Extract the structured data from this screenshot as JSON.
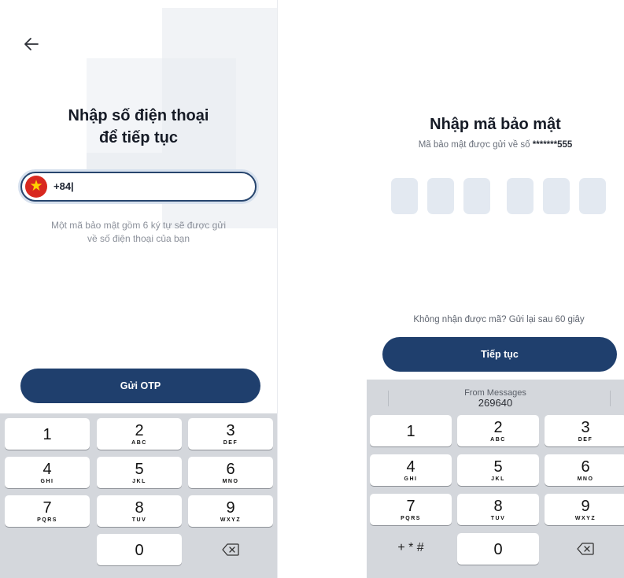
{
  "left": {
    "title_line1": "Nhập số điện thoại",
    "title_line2": "để tiếp tục",
    "phone_value": "+84|",
    "hint_line1": "Một mã bảo mật gồm 6 ký tự sẽ được gửi",
    "hint_line2": "về số điện thoại của bạn",
    "button_label": "Gửi OTP",
    "back_icon": "arrow-left-icon",
    "flag_icon": "vietnam-flag-icon"
  },
  "right": {
    "title": "Nhập mã bảo mật",
    "subtitle_prefix": "Mã bảo mật được gửi về số",
    "subtitle_number": "*******555",
    "resend_text": "Không nhận được mã? Gửi lại sau 60 giây",
    "button_label": "Tiếp tục",
    "suggestion_from": "From Messages",
    "suggestion_code": "269640",
    "special_key": "+ * #"
  },
  "keypad": {
    "keys": [
      {
        "digit": "1",
        "letters": ""
      },
      {
        "digit": "2",
        "letters": "ABC"
      },
      {
        "digit": "3",
        "letters": "DEF"
      },
      {
        "digit": "4",
        "letters": "GHI"
      },
      {
        "digit": "5",
        "letters": "JKL"
      },
      {
        "digit": "6",
        "letters": "MNO"
      },
      {
        "digit": "7",
        "letters": "PQRS"
      },
      {
        "digit": "8",
        "letters": "TUV"
      },
      {
        "digit": "9",
        "letters": "WXYZ"
      },
      {
        "digit": "0",
        "letters": ""
      }
    ],
    "delete_icon": "backspace-icon"
  },
  "colors": {
    "primary": "#1f3f6d",
    "otp_box": "#e3e9f1",
    "keypad_bg": "#d4d7dc"
  }
}
